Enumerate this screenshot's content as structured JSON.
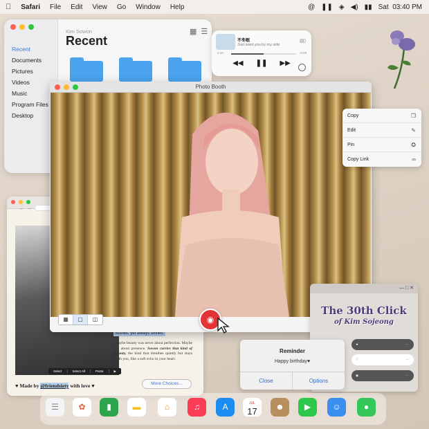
{
  "menubar": {
    "apple": "",
    "app": "Safari",
    "items": [
      "File",
      "Edit",
      "View",
      "Go",
      "Window",
      "Help"
    ],
    "date": "Sat",
    "time": "03:40 PM"
  },
  "finder": {
    "sub": "Kim Sowon",
    "title": "Recent",
    "sidebar": [
      "Recent",
      "Documents",
      "Pictures",
      "Videos",
      "Music",
      "Program Files",
      "Desktop"
    ]
  },
  "music": {
    "title": "不冬眠",
    "artist": "Just want you by my side",
    "elapsed": "2:10",
    "remaining": "-2:09",
    "progress": 0.5
  },
  "photobooth": {
    "title": "Photo Booth"
  },
  "context_menu": [
    "Copy",
    "Edit",
    "Pin",
    "Copy Link"
  ],
  "browser": {
    "highlight": "flushes, yet always shines.",
    "paragraph_start": "Maybe beauty was never about perfection. Maybe it's about presence.",
    "paragraph_italic": "Sowon carries that kind of beauty,",
    "paragraph_end": "the kind that breathes quietly but stays with you, like a soft echo in your heart.",
    "selection": [
      "Select",
      "Select All",
      "Paste"
    ],
    "made_prefix": "Made by",
    "made_tag": "@friendsiety",
    "made_suffix": "with love",
    "more": "More Choices..."
  },
  "kpanel": {
    "title": "The 30th Click",
    "subtitle": "of Kim Sojeong"
  },
  "reminder": {
    "title": "Reminder",
    "message": "Happy birthday♥",
    "close": "Close",
    "options": "Options"
  },
  "dock": {
    "calendar_month": "JUL",
    "calendar_day": "17"
  },
  "colors": {
    "accent": "#2f6fc6",
    "shutter": "#e23436",
    "panel_title": "#4a3d7a"
  }
}
